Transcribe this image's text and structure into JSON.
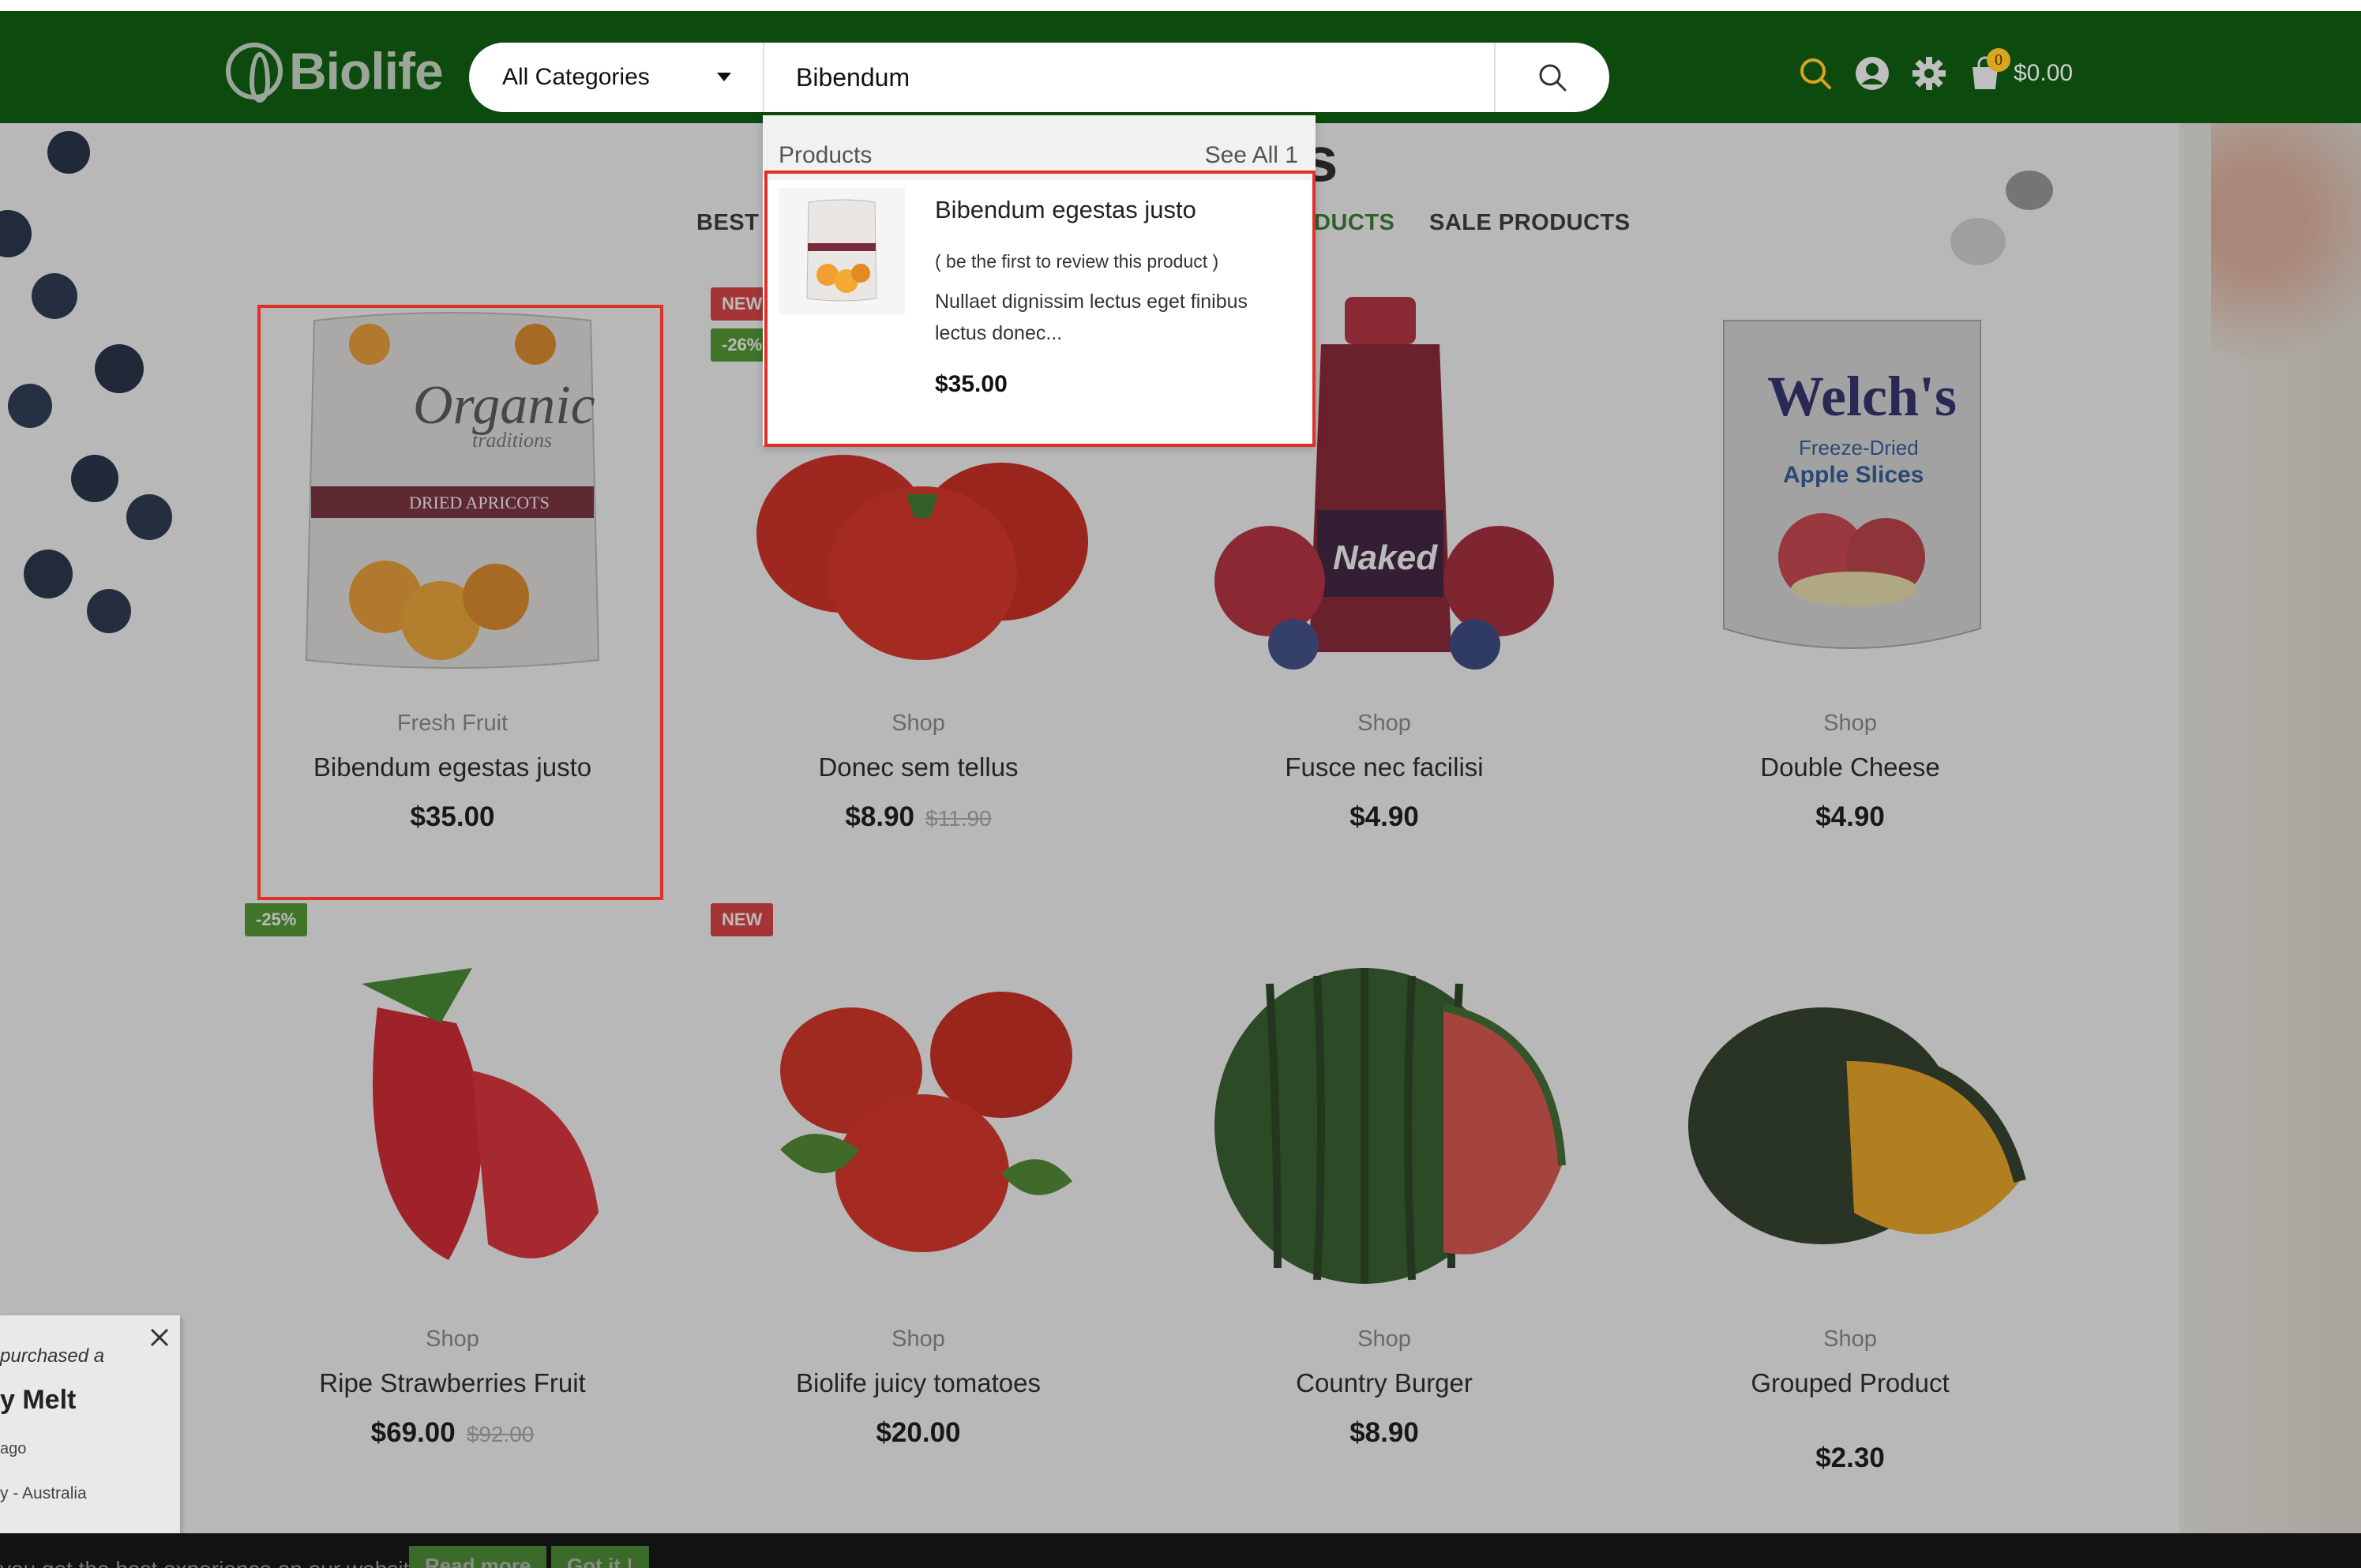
{
  "header": {
    "logo_text": "Biolife",
    "category_select": "All Categories",
    "search_value": "Bibendum",
    "cart_count": "0",
    "cart_total": "$0.00"
  },
  "section": {
    "title_fragment": "s",
    "tabs": [
      "BEST S",
      "DUCTS",
      "SALE PRODUCTS"
    ]
  },
  "search_results": {
    "group_label": "Products",
    "see_all": "See All 1",
    "item": {
      "name": "Bibendum egestas justo",
      "review_note": "( be the first to review this product )",
      "description": "Nullaet dignissim lectus eget finibus lectus donec...",
      "price": "$35.00"
    }
  },
  "products": [
    {
      "category": "Fresh Fruit",
      "name": "Bibendum egestas justo",
      "price": "$35.00",
      "old_price": ""
    },
    {
      "category": "Shop",
      "name": "Donec sem tellus",
      "price": "$8.90",
      "old_price": "$11.90",
      "badges": [
        "NEW",
        "-26%"
      ]
    },
    {
      "category": "Shop",
      "name": "Fusce nec facilisi",
      "price": "$4.90",
      "old_price": ""
    },
    {
      "category": "Shop",
      "name": "Double Cheese",
      "price": "$4.90",
      "old_price": ""
    },
    {
      "category": "Shop",
      "name": "Ripe Strawberries Fruit",
      "price": "$69.00",
      "old_price": "$92.00",
      "badges": [
        "-25%"
      ]
    },
    {
      "category": "Shop",
      "name": "Biolife juicy tomatoes",
      "price": "$20.00",
      "old_price": "",
      "badges": [
        "NEW"
      ]
    },
    {
      "category": "Shop",
      "name": "Country Burger",
      "price": "$8.90",
      "old_price": ""
    },
    {
      "category": "Shop",
      "name": "Grouped Product",
      "price": "$2.30",
      "old_price": ""
    }
  ],
  "product_images": {
    "p1_brand": "Organic",
    "p1_sub": "traditions",
    "p1_band": "DRIED APRICOTS",
    "p3_label": "Naked",
    "p4_brand": "Welch's",
    "p4_line1": "Freeze-Dried",
    "p4_line2": "Apple Slices"
  },
  "purchase_popup": {
    "line1": "purchased a",
    "line2": "y Melt",
    "line3": "ago",
    "line4": "y - Australia"
  },
  "cookie_bar": {
    "text": "you get the best experience on our website.",
    "read_more": "Read more",
    "got_it": "Got it !"
  },
  "colors": {
    "header_bg": "#0d4a0d",
    "highlight": "#e0302a",
    "badge_new": "#e03b3b",
    "badge_sale": "#4c9a2a",
    "accent_green": "#2f7d2f"
  }
}
